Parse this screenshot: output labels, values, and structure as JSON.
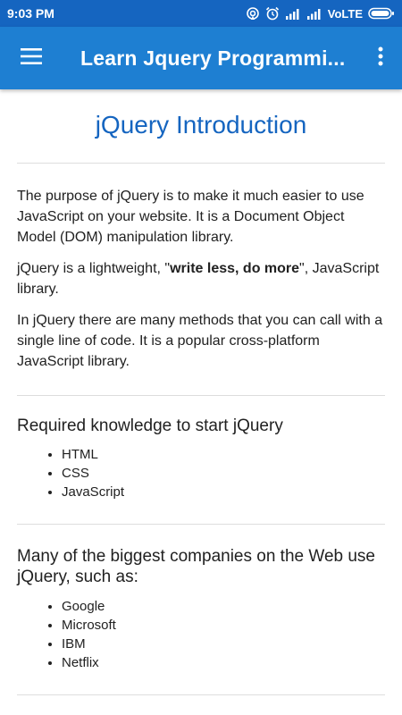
{
  "status_bar": {
    "time": "9:03 PM",
    "network": "VoLTE"
  },
  "app_bar": {
    "title": "Learn Jquery Programmi...",
    "menu_icon": "hamburger-menu-icon",
    "overflow_icon": "more-vert-icon",
    "color": "#1e7fd2"
  },
  "article": {
    "title": "jQuery Introduction",
    "title_color": "#1565c0",
    "intro_paragraphs": [
      "The purpose of jQuery is to make it much easier to use JavaScript on your website. It is a Document Object Model (DOM) manipulation library.",
      {
        "before": "jQuery is a lightweight, \"",
        "bold": "write less, do more",
        "after": "\", JavaScript library."
      },
      "In jQuery there are many methods that you can call with a single line of code. It is a popular cross-platform JavaScript library."
    ],
    "sections": [
      {
        "heading": "Required knowledge to start jQuery",
        "items": [
          "HTML",
          "CSS",
          "JavaScript"
        ]
      },
      {
        "heading": "Many of the biggest companies on the Web use jQuery, such as:",
        "items": [
          "Google",
          "Microsoft",
          "IBM",
          "Netflix"
        ]
      }
    ]
  }
}
